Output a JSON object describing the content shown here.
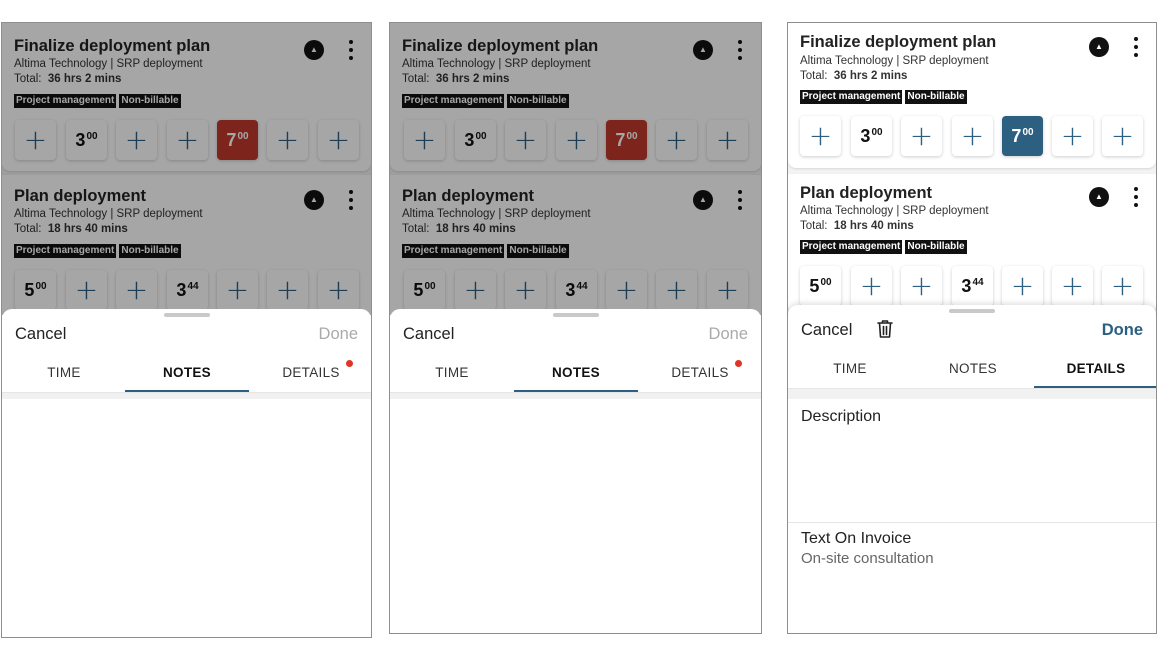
{
  "screens": [
    {
      "cards": [
        {
          "title": "Finalize deployment plan",
          "subtitle": "Altima Technology | SRP deployment",
          "total_label": "Total:",
          "total_value": "36 hrs 2 mins",
          "tags": [
            "Project management",
            "Non-billable"
          ],
          "days": [
            {
              "type": "add",
              "symbol": "+"
            },
            {
              "type": "value",
              "main": "3",
              "sup": "00"
            },
            {
              "type": "add",
              "symbol": "+"
            },
            {
              "type": "add",
              "symbol": "+"
            },
            {
              "type": "value",
              "main": "7",
              "sup": "00",
              "highlight": "red"
            },
            {
              "type": "add",
              "symbol": "+"
            },
            {
              "type": "add",
              "symbol": "+"
            }
          ]
        },
        {
          "title": "Plan deployment",
          "subtitle": "Altima Technology | SRP deployment",
          "total_label": "Total:",
          "total_value": "18 hrs 40 mins",
          "tags": [
            "Project management",
            "Non-billable"
          ],
          "days": [
            {
              "type": "value",
              "main": "5",
              "sup": "00"
            },
            {
              "type": "add",
              "symbol": "+"
            },
            {
              "type": "add",
              "symbol": "+"
            },
            {
              "type": "value",
              "main": "3",
              "sup": "44"
            },
            {
              "type": "add",
              "symbol": "+"
            },
            {
              "type": "add",
              "symbol": "+"
            },
            {
              "type": "add",
              "symbol": "+"
            }
          ]
        }
      ],
      "sheet": {
        "cancel": "Cancel",
        "done": "Done",
        "done_enabled": false,
        "tabs": [
          "TIME",
          "NOTES",
          "DETAILS"
        ],
        "active_tab": 1,
        "details_badge": true
      }
    },
    {
      "cards": [
        {
          "title": "Finalize deployment plan",
          "subtitle": "Altima Technology | SRP deployment",
          "total_label": "Total:",
          "total_value": "36 hrs 2 mins",
          "tags": [
            "Project management",
            "Non-billable"
          ],
          "days": [
            {
              "type": "add",
              "symbol": "+"
            },
            {
              "type": "value",
              "main": "3",
              "sup": "00"
            },
            {
              "type": "add",
              "symbol": "+"
            },
            {
              "type": "add",
              "symbol": "+"
            },
            {
              "type": "value",
              "main": "7",
              "sup": "00",
              "highlight": "red"
            },
            {
              "type": "add",
              "symbol": "+"
            },
            {
              "type": "add",
              "symbol": "+"
            }
          ]
        },
        {
          "title": "Plan deployment",
          "subtitle": "Altima Technology | SRP deployment",
          "total_label": "Total:",
          "total_value": "18 hrs 40 mins",
          "tags": [
            "Project management",
            "Non-billable"
          ],
          "days": [
            {
              "type": "value",
              "main": "5",
              "sup": "00"
            },
            {
              "type": "add",
              "symbol": "+"
            },
            {
              "type": "add",
              "symbol": "+"
            },
            {
              "type": "value",
              "main": "3",
              "sup": "44"
            },
            {
              "type": "add",
              "symbol": "+"
            },
            {
              "type": "add",
              "symbol": "+"
            },
            {
              "type": "add",
              "symbol": "+"
            }
          ]
        }
      ],
      "sheet": {
        "cancel": "Cancel",
        "done": "Done",
        "done_enabled": false,
        "tabs": [
          "TIME",
          "NOTES",
          "DETAILS"
        ],
        "active_tab": 1,
        "details_badge": true
      }
    },
    {
      "cards": [
        {
          "title": "Finalize deployment plan",
          "subtitle": "Altima Technology | SRP deployment",
          "total_label": "Total:",
          "total_value": "36 hrs 2 mins",
          "tags": [
            "Project management",
            "Non-billable"
          ],
          "days": [
            {
              "type": "add",
              "symbol": "+"
            },
            {
              "type": "value",
              "main": "3",
              "sup": "00"
            },
            {
              "type": "add",
              "symbol": "+"
            },
            {
              "type": "add",
              "symbol": "+"
            },
            {
              "type": "value",
              "main": "7",
              "sup": "00",
              "highlight": "teal"
            },
            {
              "type": "add",
              "symbol": "+"
            },
            {
              "type": "add",
              "symbol": "+"
            }
          ]
        },
        {
          "title": "Plan deployment",
          "subtitle": "Altima Technology | SRP deployment",
          "total_label": "Total:",
          "total_value": "18 hrs 40 mins",
          "tags": [
            "Project management",
            "Non-billable"
          ],
          "days": [
            {
              "type": "value",
              "main": "5",
              "sup": "00"
            },
            {
              "type": "add",
              "symbol": "+"
            },
            {
              "type": "add",
              "symbol": "+"
            },
            {
              "type": "value",
              "main": "3",
              "sup": "44"
            },
            {
              "type": "add",
              "symbol": "+"
            },
            {
              "type": "add",
              "symbol": "+"
            },
            {
              "type": "add",
              "symbol": "+"
            }
          ]
        }
      ],
      "sheet": {
        "cancel": "Cancel",
        "done": "Done",
        "done_enabled": true,
        "tabs": [
          "TIME",
          "NOTES",
          "DETAILS"
        ],
        "active_tab": 2,
        "details_badge": false,
        "fields": [
          {
            "label": "Description",
            "value": ""
          },
          {
            "label": "Text On Invoice",
            "value": "On-site consultation"
          }
        ]
      }
    }
  ],
  "icons": {
    "collapse": "chevron-double-up-icon",
    "more": "kebab-menu-icon",
    "add": "plus-icon",
    "delete": "trash-icon"
  },
  "colors": {
    "accent": "#2c5f80",
    "highlight_red": "#c0392b",
    "badge": "#e03424",
    "tag_bg": "#111111"
  }
}
